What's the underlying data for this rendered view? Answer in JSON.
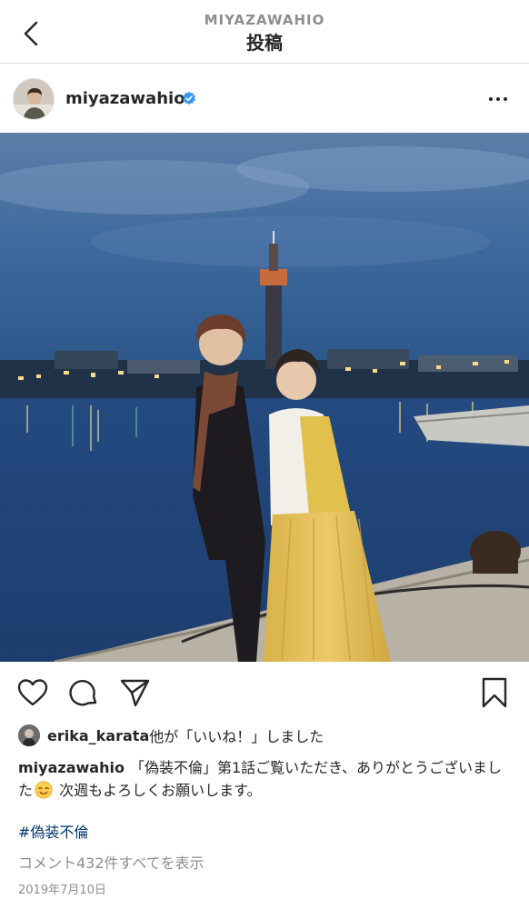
{
  "header": {
    "account": "MIYAZAWAHIO",
    "title": "投稿"
  },
  "post": {
    "username": "miyazawahio",
    "verified": true
  },
  "likes": {
    "user": "erika_karata",
    "text": "他が「いいね！」しました"
  },
  "caption": {
    "username": "miyazawahio",
    "text_part1": "「偽装不倫」第1話ご覧いただき、ありがとうございました",
    "emoji": "smiling-face",
    "text_part2": " 次週もよろしくお願いします。",
    "hashtag": "#偽装不倫"
  },
  "comments": {
    "link_text": "コメント432件すべてを表示"
  },
  "date": "2019年7月10日",
  "icons": {
    "back": "chevron-left-icon",
    "more": "more-options-icon",
    "like": "heart-icon",
    "comment": "comment-icon",
    "share": "send-icon",
    "save": "bookmark-icon"
  },
  "colors": {
    "verified": "#3897f0",
    "hashtag": "#00376b",
    "secondary_text": "#8e8e8e"
  }
}
